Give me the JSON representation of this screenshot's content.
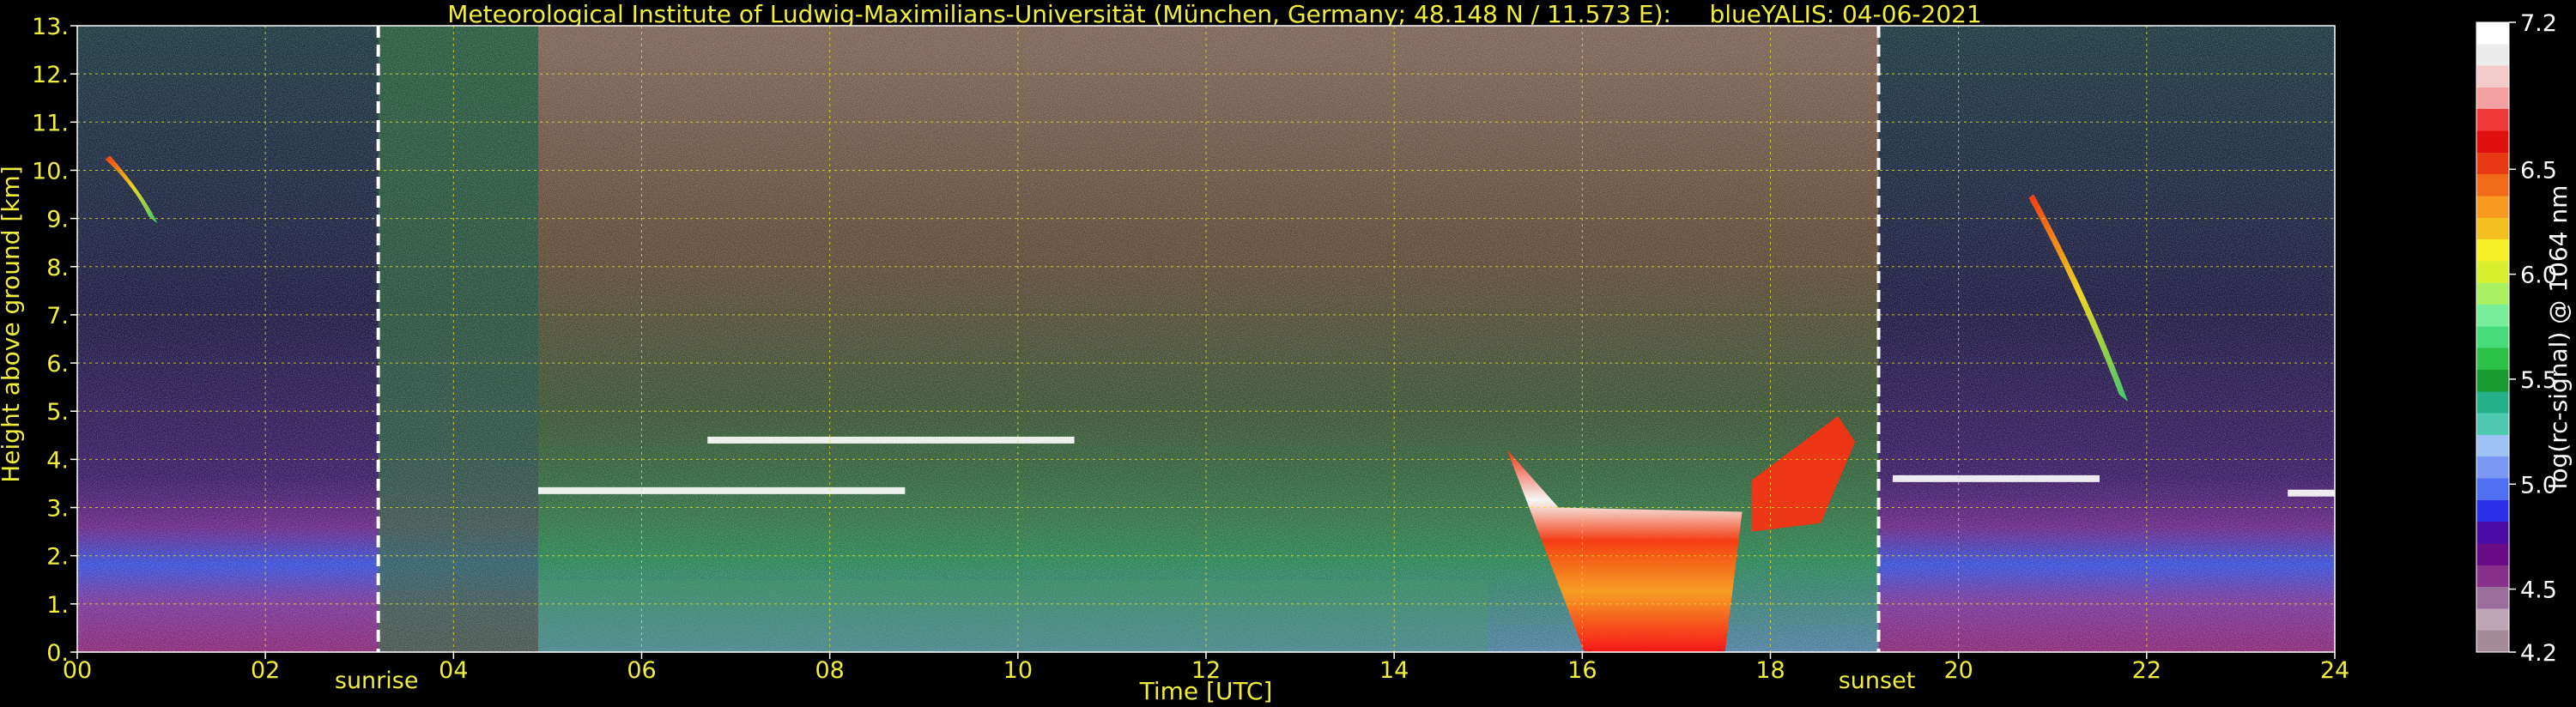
{
  "chart_data": {
    "type": "heatmap",
    "title": "Meteorological Institute of Ludwig-Maximilians-Universität (München, Germany; 48.148 N / 11.573 E):     blueYALIS: 04-06-2021",
    "xlabel": "Time [UTC]",
    "ylabel": "Height above ground [km]",
    "xlim": [
      0,
      24
    ],
    "ylim": [
      0,
      13
    ],
    "x_ticks": [
      "00",
      "02",
      "04",
      "06",
      "08",
      "10",
      "12",
      "14",
      "16",
      "18",
      "20",
      "22",
      "24"
    ],
    "y_ticks": [
      "0.",
      "1.",
      "2.",
      "3.",
      "4.",
      "5.",
      "6.",
      "7.",
      "8.",
      "9.",
      "10.",
      "11.",
      "12.",
      "13."
    ],
    "grid": true,
    "annotations": [
      {
        "label": "sunrise",
        "x": 3.2
      },
      {
        "label": "sunset",
        "x": 19.15
      }
    ],
    "colorbar": {
      "label": "log(rc-signal) @ 1064 nm",
      "range": [
        4.2,
        7.2
      ],
      "ticks": [
        "4.2",
        "4.5",
        "5.0",
        "5.5",
        "6.0",
        "6.5",
        "7.2"
      ],
      "colors": [
        "#a58a98",
        "#bfa6b6",
        "#9b6f9b",
        "#86308a",
        "#6a0c88",
        "#4a0ea6",
        "#2a2ee6",
        "#4f6ff2",
        "#7b98f4",
        "#9ec2f4",
        "#4fc8b0",
        "#22b088",
        "#189a30",
        "#2cc048",
        "#46dc7a",
        "#78ee98",
        "#a8f060",
        "#d8f030",
        "#f6f028",
        "#f4c020",
        "#f89a20",
        "#f06a1a",
        "#e83a14",
        "#e01010",
        "#f03a3a",
        "#f4a0a0",
        "#f4cccc",
        "#ececec",
        "#ffffff"
      ]
    },
    "features": [
      {
        "kind": "cirrus",
        "x_start": 0.35,
        "x_end": 0.85,
        "y_start": 10.3,
        "y_end": 8.9
      },
      {
        "kind": "aerosol_layer_top",
        "x_start": 4.9,
        "x_end": 8.8,
        "y": 3.35
      },
      {
        "kind": "aerosol_layer_top",
        "x_start": 6.7,
        "x_end": 10.6,
        "y": 4.4
      },
      {
        "kind": "convective_cloud",
        "x_start": 15.2,
        "x_end": 17.7,
        "y_base": 0.0,
        "y_top": 3.0
      },
      {
        "kind": "cloud_tower",
        "x_start": 17.8,
        "x_end": 18.9,
        "y_base": 2.5,
        "y_top": 4.9
      },
      {
        "kind": "cirrus",
        "x_start": 20.8,
        "x_end": 21.8,
        "y_start": 9.5,
        "y_end": 5.2
      },
      {
        "kind": "aerosol_layer_top",
        "x_start": 19.3,
        "x_end": 21.5,
        "y": 3.6
      },
      {
        "kind": "aerosol_layer_top",
        "x_start": 23.5,
        "x_end": 24.0,
        "y": 3.3
      }
    ]
  }
}
